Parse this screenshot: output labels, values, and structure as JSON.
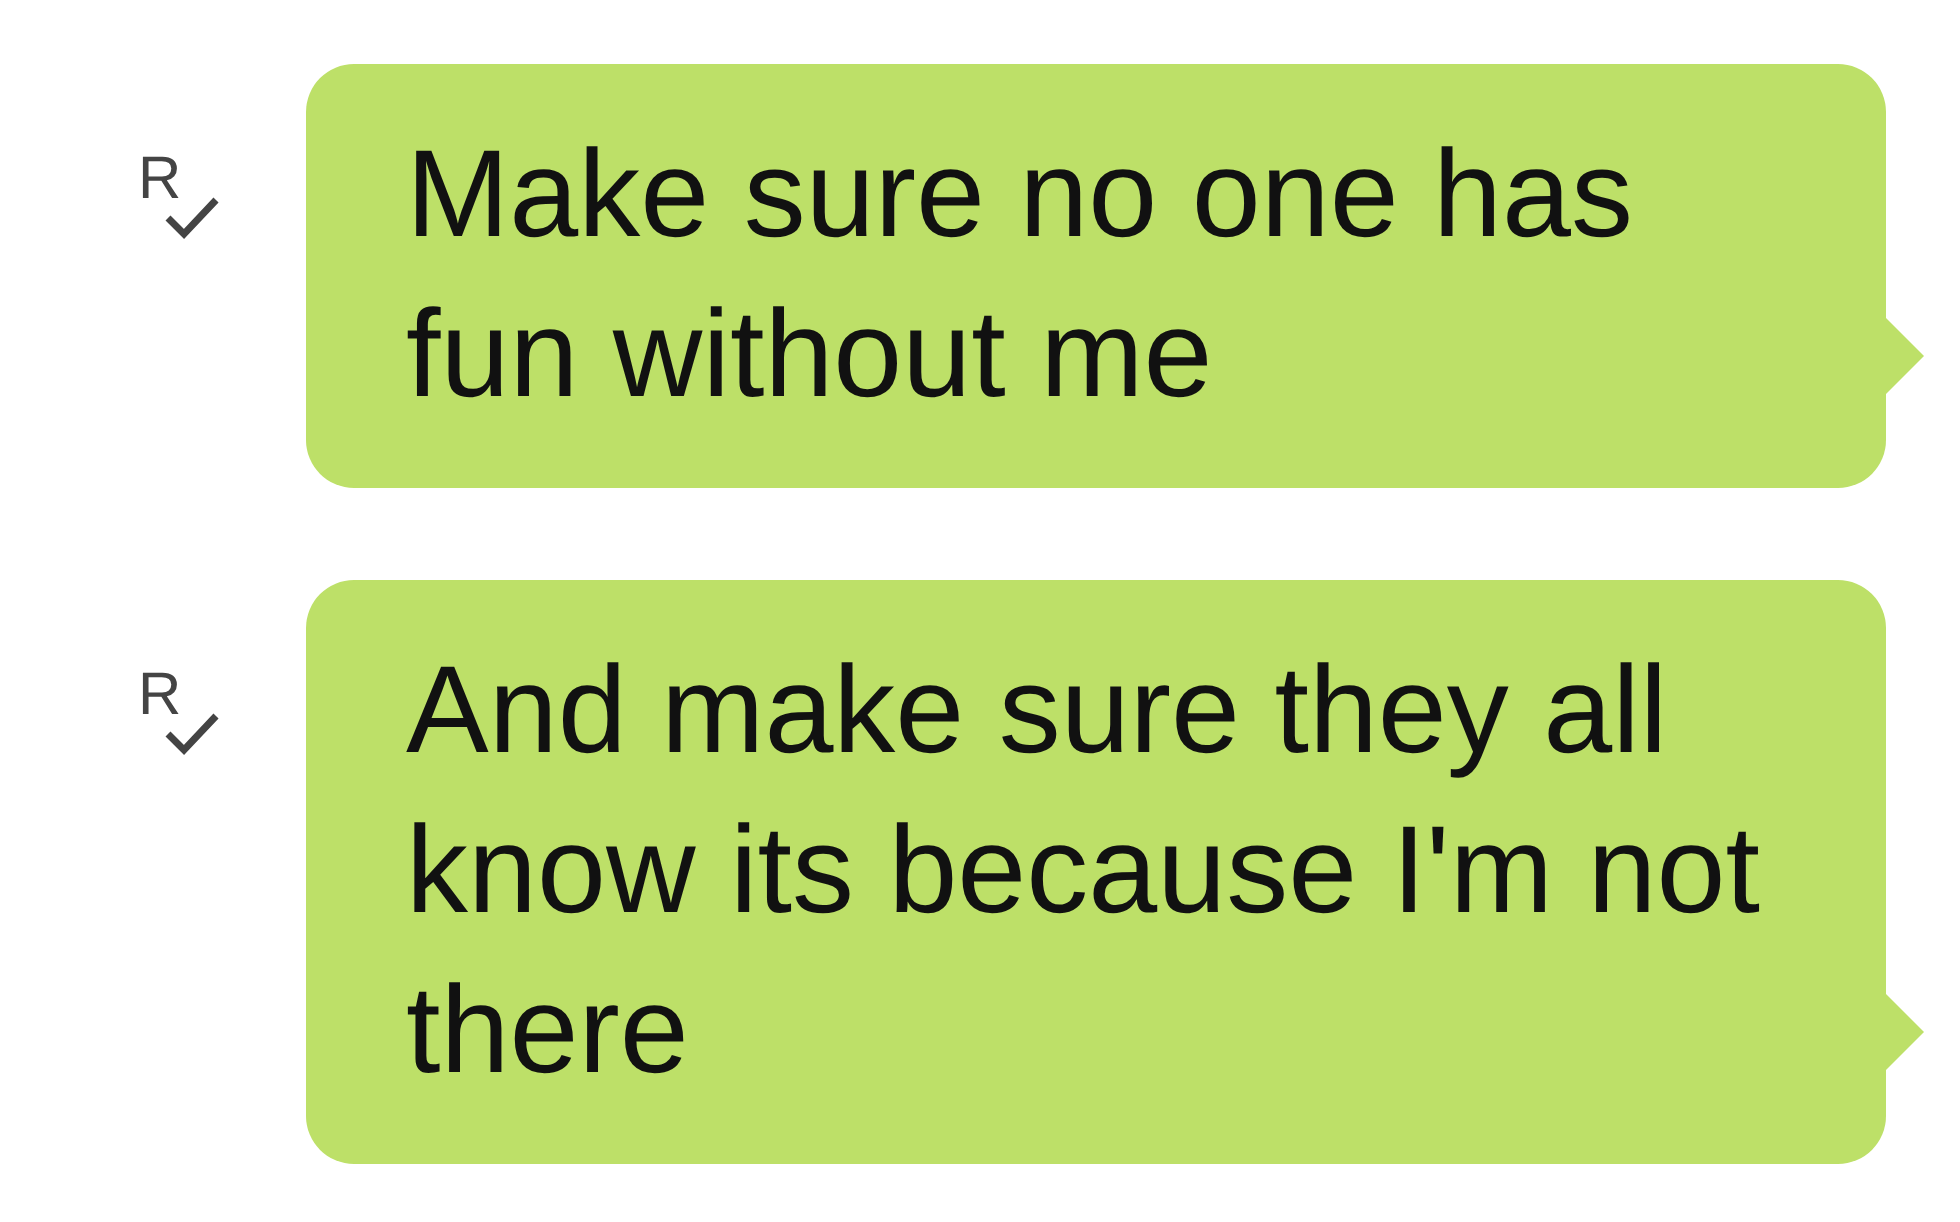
{
  "messages": [
    {
      "text": "Make sure no one has fun without me",
      "read_mark": "R",
      "read": true
    },
    {
      "text": "And make sure they all know its because I'm not there",
      "read_mark": "R",
      "read": true
    }
  ]
}
